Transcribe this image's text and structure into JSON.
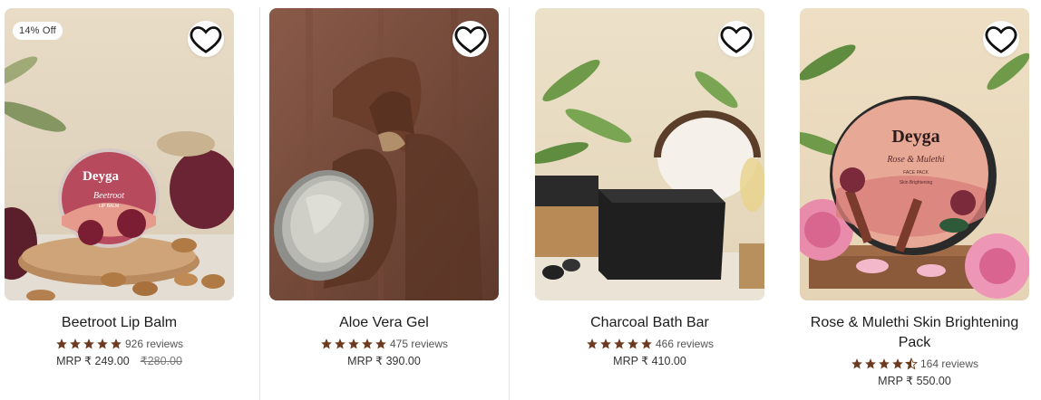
{
  "products": [
    {
      "title": "Beetroot Lip Balm",
      "badge": "14% Off",
      "rating": 5,
      "reviews": "926 reviews",
      "price": "MRP ₹ 249.00",
      "compare_price": "₹280.00",
      "brand_text": "Deyga",
      "jar_text": "Beetroot",
      "jar_subtext": "LIP BALM"
    },
    {
      "title": "Aloe Vera Gel",
      "rating": 5,
      "reviews": "475 reviews",
      "price": "MRP ₹ 390.00"
    },
    {
      "title": "Charcoal Bath Bar",
      "rating": 5,
      "reviews": "466 reviews",
      "price": "MRP ₹ 410.00"
    },
    {
      "title": "Rose & Mulethi Skin Brightening Pack",
      "rating": 4.5,
      "reviews": "164 reviews",
      "price": "MRP ₹ 550.00",
      "brand_text": "Deyga",
      "jar_text": "Rose & Mulethi",
      "jar_subtext": "FACE PACK",
      "jar_subtext2": "Skin Brightening"
    }
  ],
  "colors": {
    "star": "#6b3a1f",
    "text": "#1c1c1c",
    "muted": "#555555"
  },
  "icons": {
    "wishlist": "heart-outline-icon",
    "star": "star-icon",
    "half_star": "half-star-icon"
  }
}
